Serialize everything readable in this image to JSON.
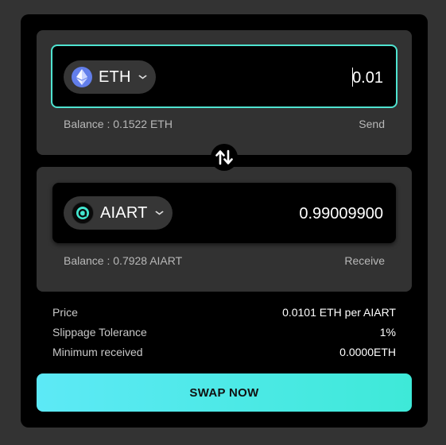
{
  "from": {
    "token_symbol": "ETH",
    "token_icon": "ethereum-icon",
    "amount": "0.01",
    "balance_text": "Balance : 0.1522 ETH",
    "action_label": "Send"
  },
  "to": {
    "token_symbol": "AIART",
    "token_icon": "aiart-icon",
    "amount": "0.99009900",
    "balance_text": "Balance : 0.7928 AIART",
    "action_label": "Receive"
  },
  "swap_toggle_icon": "swap-arrows-icon",
  "details": [
    {
      "label": "Price",
      "value": "0.0101 ETH per AIART"
    },
    {
      "label": "Slippage Tolerance",
      "value": "1%"
    },
    {
      "label": "Minimum received",
      "value": "0.0000ETH"
    }
  ],
  "swap_button_label": "SWAP NOW",
  "colors": {
    "accent": "#4fe3d0",
    "button_gradient_start": "#5de9f6",
    "button_gradient_end": "#3ee9d8",
    "background": "#333333",
    "card": "#000000",
    "panel": "#323232"
  }
}
